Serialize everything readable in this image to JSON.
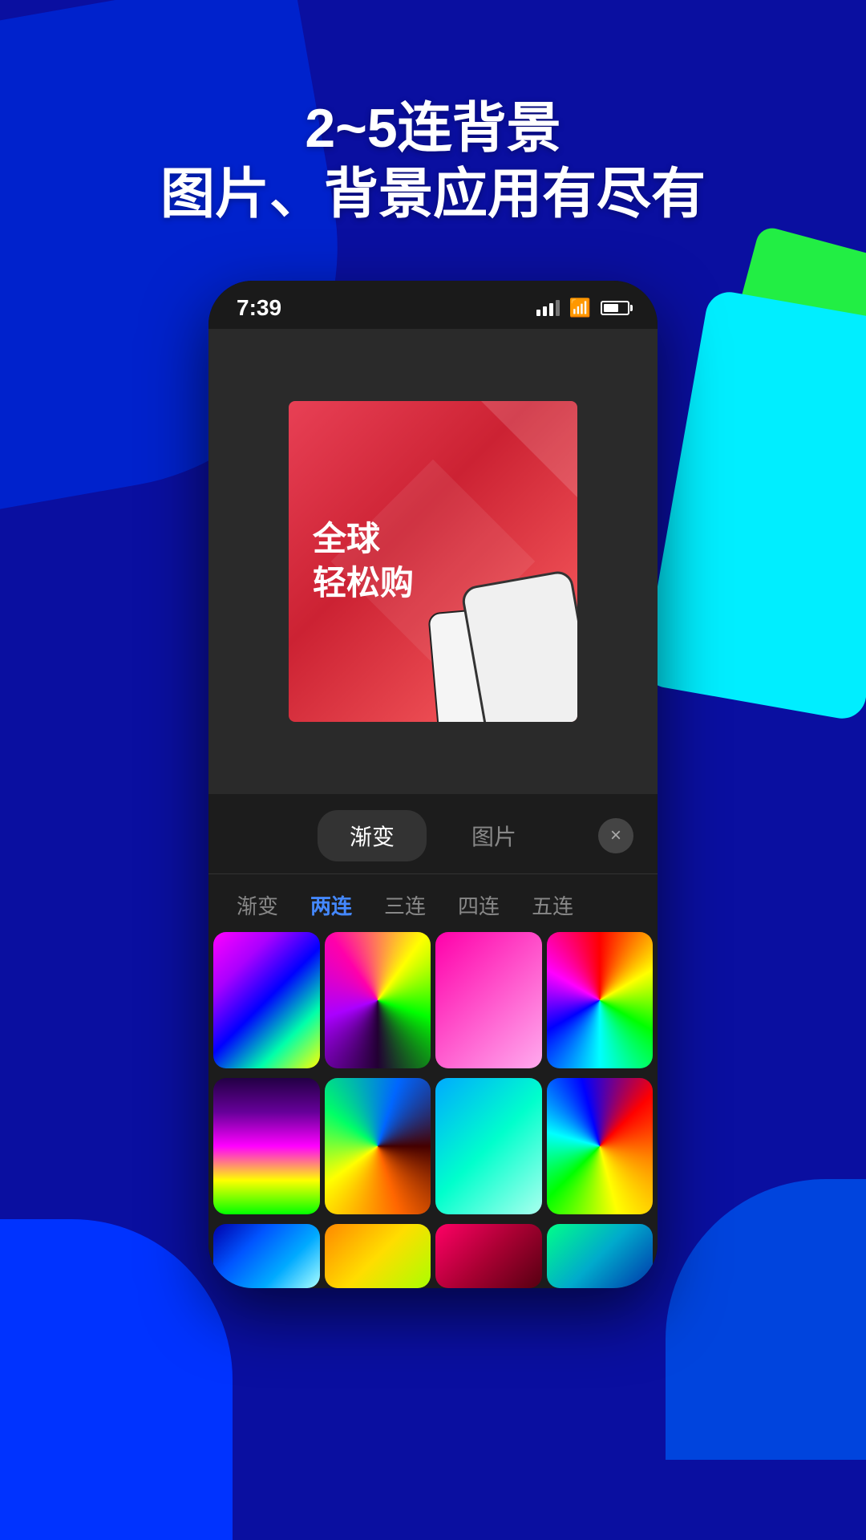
{
  "background": {
    "color": "#0a0fa0"
  },
  "header": {
    "line1": "2~5连背景",
    "line2": "图片、背景应用有尽有"
  },
  "statusBar": {
    "time": "7:39",
    "signal": "signal-icon",
    "wifi": "wifi-icon",
    "battery": "battery-icon"
  },
  "promoCard": {
    "line1": "全球",
    "line2": "轻松购"
  },
  "tabs": {
    "active": "渐变",
    "inactive": "图片",
    "close_label": "×"
  },
  "subtabs": [
    {
      "label": "渐变",
      "active": false
    },
    {
      "label": "两连",
      "active": true
    },
    {
      "label": "三连",
      "active": false
    },
    {
      "label": "四连",
      "active": false
    },
    {
      "label": "五连",
      "active": false
    }
  ],
  "gradients": [
    {
      "id": "g1",
      "class": "g1"
    },
    {
      "id": "g2",
      "class": "g2"
    },
    {
      "id": "g3",
      "class": "g3"
    },
    {
      "id": "g4",
      "class": "g4"
    },
    {
      "id": "g5",
      "class": "g5"
    },
    {
      "id": "g6",
      "class": "g6"
    },
    {
      "id": "g7",
      "class": "g7"
    },
    {
      "id": "g8",
      "class": "g8"
    }
  ]
}
